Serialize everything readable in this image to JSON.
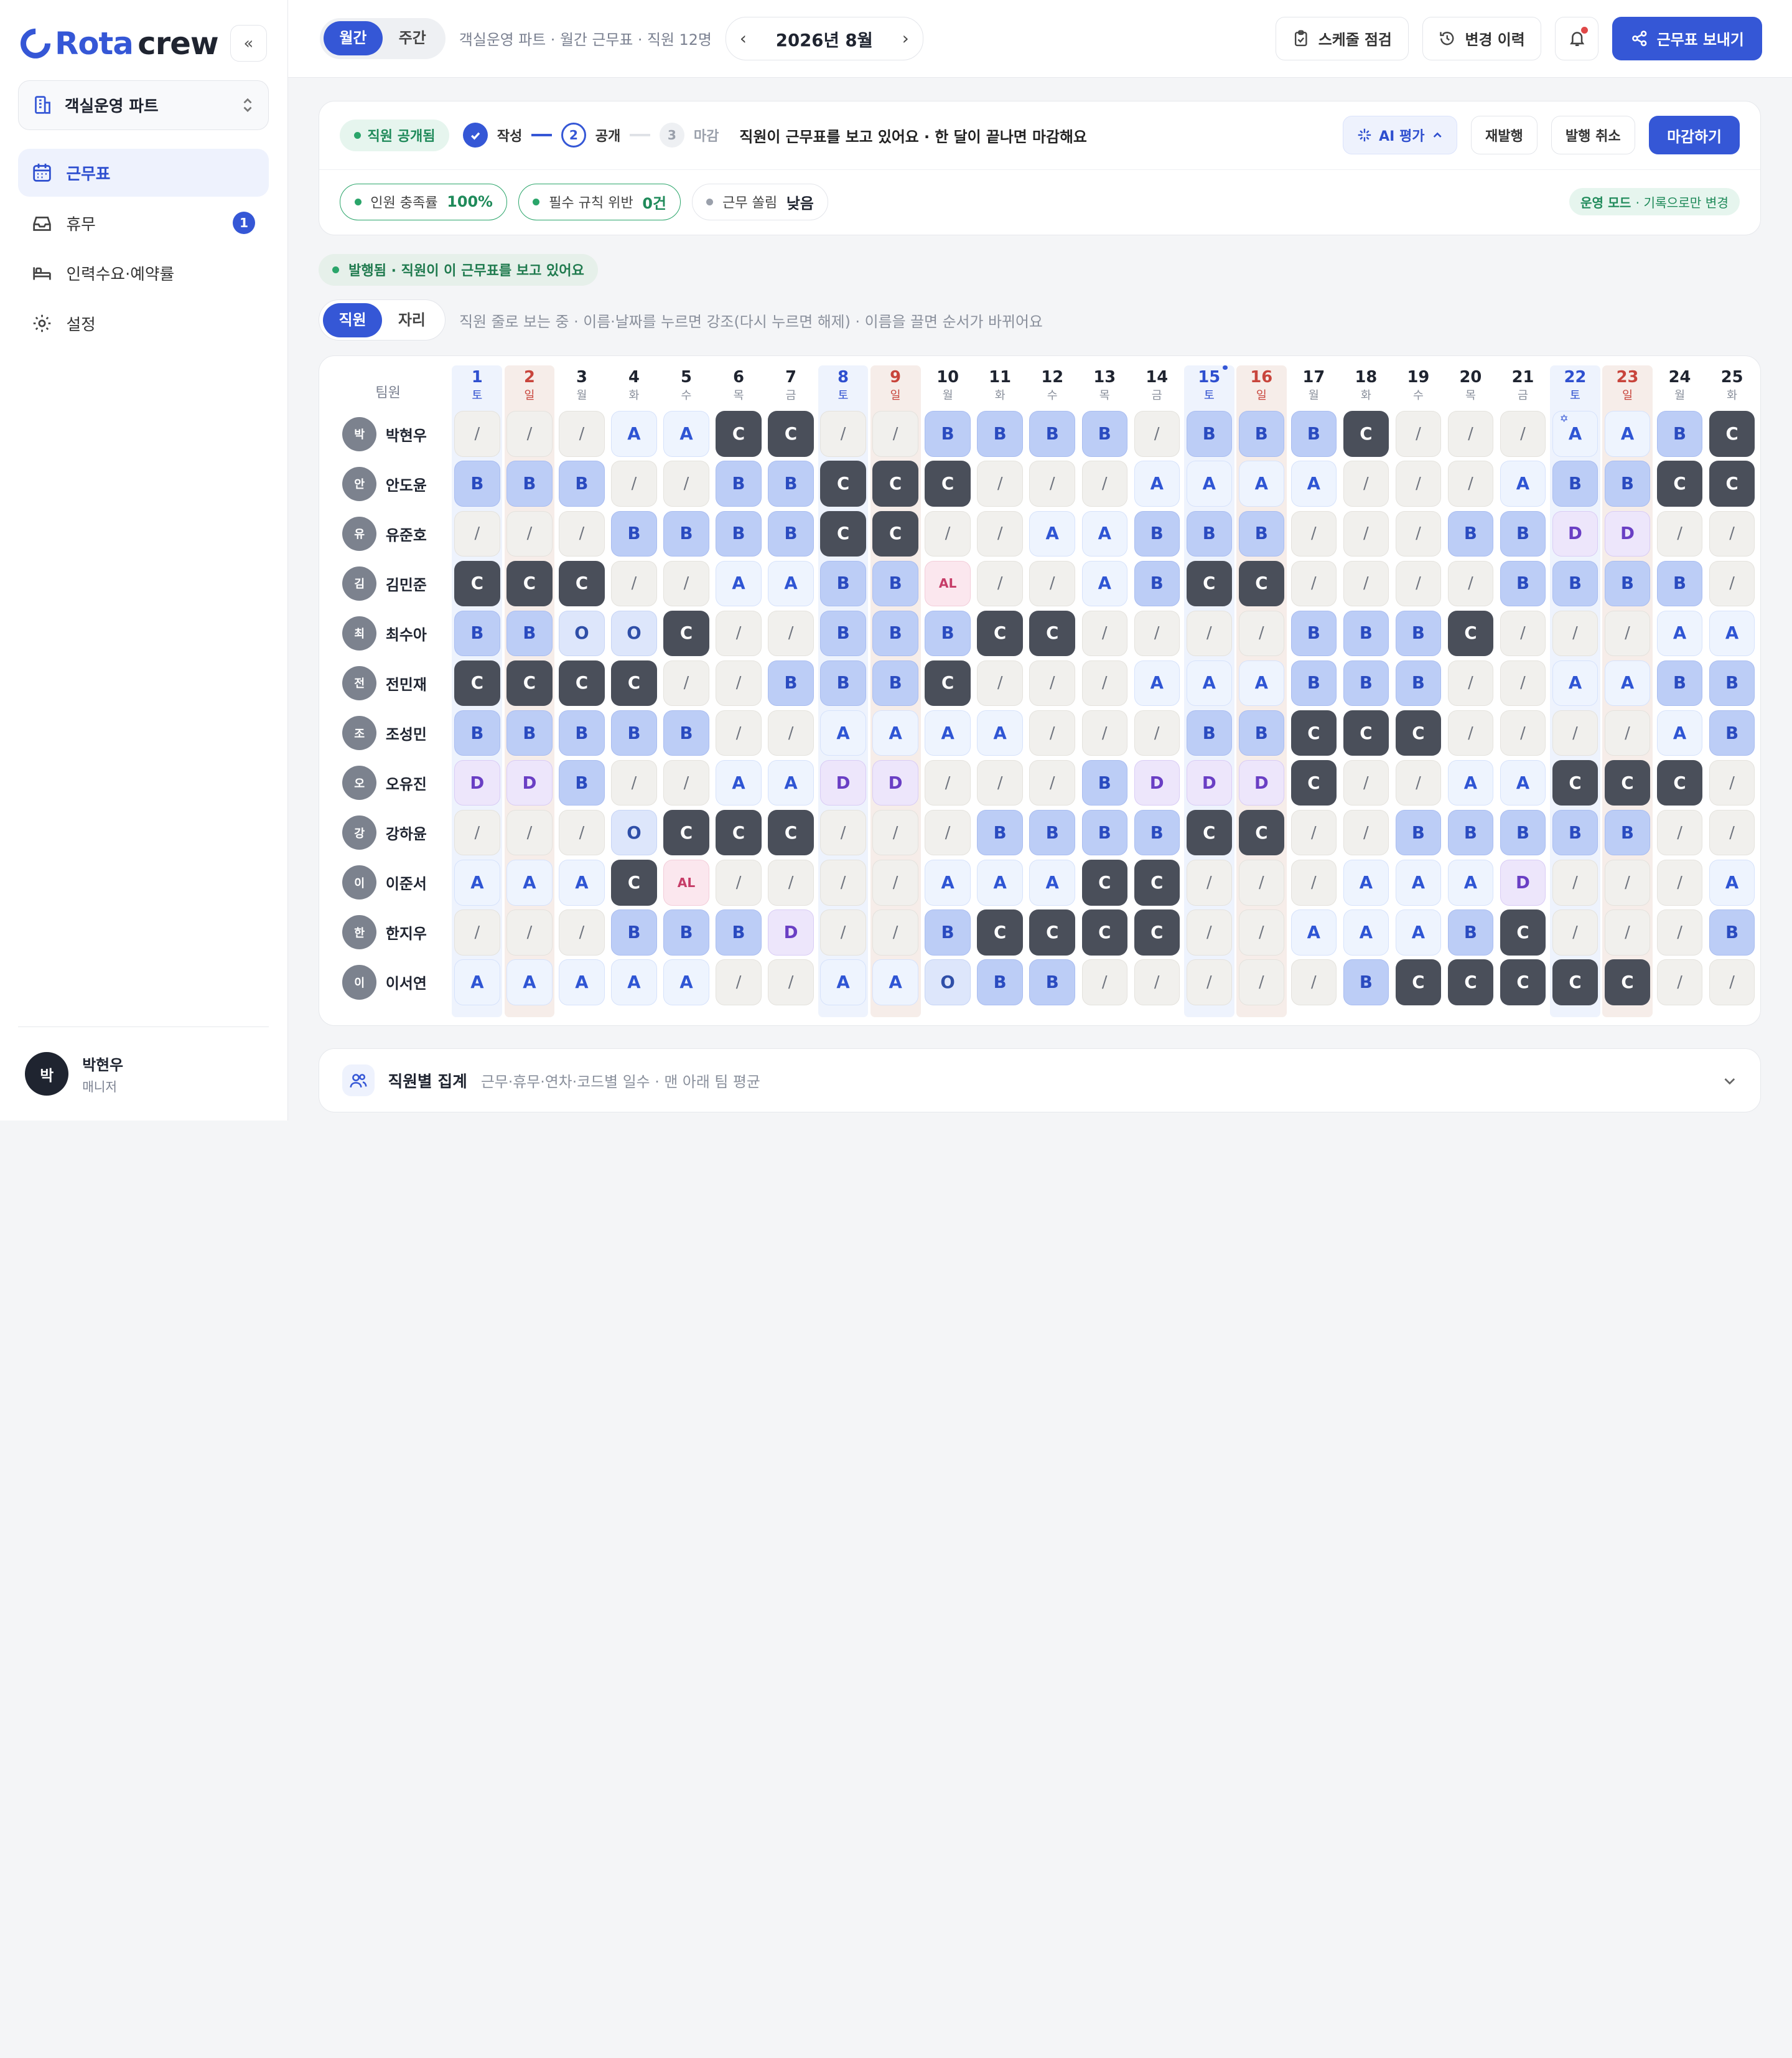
{
  "app": {
    "logo_rota": "Rota",
    "logo_crew": "crew",
    "collapse_glyph": "«"
  },
  "sidebar": {
    "team": "객실운영 파트",
    "items": [
      {
        "label": "근무표",
        "icon": "calendar-icon",
        "active": true
      },
      {
        "label": "휴무",
        "icon": "inbox-icon",
        "badge": "1"
      },
      {
        "label": "인력수요·예약률",
        "icon": "bed-icon"
      },
      {
        "label": "설정",
        "icon": "gear-icon"
      }
    ],
    "user": {
      "initial": "박",
      "name": "박현우",
      "role": "매니저"
    }
  },
  "topbar": {
    "view_monthly": "월간",
    "view_weekly": "주간",
    "crumb": "객실운영 파트 · 월간 근무표 · 직원 12명",
    "month": "2026년 8월",
    "prev": "‹",
    "next": "›",
    "check_btn": "스케줄 점검",
    "history_btn": "변경 이력",
    "send_btn": "근무표 보내기"
  },
  "status": {
    "state_pill": "직원 공개됨",
    "step1": "작성",
    "step2_num": "2",
    "step2": "공개",
    "step3_num": "3",
    "step3": "마감",
    "message": "직원이 근무표를 보고 있어요 · 한 달이 끝나면 마감해요",
    "ai_btn": "AI 평가",
    "reissue_btn": "재발행",
    "cancel_btn": "발행 취소",
    "close_btn": "마감하기",
    "metric1_label": "인원 충족률",
    "metric1_value": "100%",
    "metric2_label": "필수 규칙 위반",
    "metric2_value": "0건",
    "metric3_label": "근무 쏠림",
    "metric3_value": "낮음",
    "mode_bold": "운영 모드",
    "mode_rest": "· 기록으로만 변경"
  },
  "published_pill": "발행됨 · 직원이 이 근무표를 보고 있어요",
  "view": {
    "by_staff": "직원",
    "by_seat": "자리",
    "hint": "직원 줄로 보는 중 · 이름·날짜를 누르면 강조(다시 누르면 해제) · 이름을 끌면 순서가 바뀌어요"
  },
  "grid": {
    "team_header": "팀원",
    "days": [
      {
        "n": "1",
        "w": "토",
        "t": "sat"
      },
      {
        "n": "2",
        "w": "일",
        "t": "sun"
      },
      {
        "n": "3",
        "w": "월"
      },
      {
        "n": "4",
        "w": "화"
      },
      {
        "n": "5",
        "w": "수"
      },
      {
        "n": "6",
        "w": "목"
      },
      {
        "n": "7",
        "w": "금"
      },
      {
        "n": "8",
        "w": "토",
        "t": "sat"
      },
      {
        "n": "9",
        "w": "일",
        "t": "sun"
      },
      {
        "n": "10",
        "w": "월"
      },
      {
        "n": "11",
        "w": "화"
      },
      {
        "n": "12",
        "w": "수"
      },
      {
        "n": "13",
        "w": "목"
      },
      {
        "n": "14",
        "w": "금"
      },
      {
        "n": "15",
        "w": "토",
        "t": "sat",
        "dot": true
      },
      {
        "n": "16",
        "w": "일",
        "t": "sun"
      },
      {
        "n": "17",
        "w": "월"
      },
      {
        "n": "18",
        "w": "화"
      },
      {
        "n": "19",
        "w": "수"
      },
      {
        "n": "20",
        "w": "목"
      },
      {
        "n": "21",
        "w": "금"
      },
      {
        "n": "22",
        "w": "토",
        "t": "sat"
      },
      {
        "n": "23",
        "w": "일",
        "t": "sun"
      },
      {
        "n": "24",
        "w": "월"
      },
      {
        "n": "25",
        "w": "화"
      }
    ],
    "staff": [
      {
        "initial": "박",
        "name": "박현우",
        "shifts": [
          "/",
          "/",
          "/",
          "A",
          "A",
          "C",
          "C",
          "/",
          "/",
          "B",
          "B",
          "B",
          "B",
          "/",
          "B",
          "B",
          "B",
          "C",
          "/",
          "/",
          "/",
          "A*",
          "A",
          "B",
          "C"
        ]
      },
      {
        "initial": "안",
        "name": "안도윤",
        "shifts": [
          "B",
          "B",
          "B",
          "/",
          "/",
          "B",
          "B",
          "C",
          "C",
          "C",
          "/",
          "/",
          "/",
          "A",
          "A",
          "A",
          "A",
          "/",
          "/",
          "/",
          "A",
          "B",
          "B",
          "C",
          "C"
        ]
      },
      {
        "initial": "유",
        "name": "유준호",
        "shifts": [
          "/",
          "/",
          "/",
          "B",
          "B",
          "B",
          "B",
          "C",
          "C",
          "/",
          "/",
          "A",
          "A",
          "B",
          "B",
          "B",
          "/",
          "/",
          "/",
          "B",
          "B",
          "D",
          "D",
          "/",
          "/"
        ]
      },
      {
        "initial": "김",
        "name": "김민준",
        "shifts": [
          "C",
          "C",
          "C",
          "/",
          "/",
          "A",
          "A",
          "B",
          "B",
          "AL",
          "/",
          "/",
          "A",
          "B",
          "C",
          "C",
          "/",
          "/",
          "/",
          "/",
          "B",
          "B",
          "B",
          "B",
          "/"
        ]
      },
      {
        "initial": "최",
        "name": "최수아",
        "shifts": [
          "B",
          "B",
          "O",
          "O",
          "C",
          "/",
          "/",
          "B",
          "B",
          "B",
          "C",
          "C",
          "/",
          "/",
          "/",
          "/",
          "B",
          "B",
          "B",
          "C",
          "/",
          "/",
          "/",
          "A",
          "A"
        ]
      },
      {
        "initial": "전",
        "name": "전민재",
        "shifts": [
          "C",
          "C",
          "C",
          "C",
          "/",
          "/",
          "B",
          "B",
          "B",
          "C",
          "/",
          "/",
          "/",
          "A",
          "A",
          "A",
          "B",
          "B",
          "B",
          "/",
          "/",
          "A",
          "A",
          "B",
          "B"
        ]
      },
      {
        "initial": "조",
        "name": "조성민",
        "shifts": [
          "B",
          "B",
          "B",
          "B",
          "B",
          "/",
          "/",
          "A",
          "A",
          "A",
          "A",
          "/",
          "/",
          "/",
          "B",
          "B",
          "C",
          "C",
          "C",
          "/",
          "/",
          "/",
          "/",
          "A",
          "B"
        ]
      },
      {
        "initial": "오",
        "name": "오유진",
        "shifts": [
          "D",
          "D",
          "B",
          "/",
          "/",
          "A",
          "A",
          "D",
          "D",
          "/",
          "/",
          "/",
          "B",
          "D",
          "D",
          "D",
          "C",
          "/",
          "/",
          "A",
          "A",
          "C",
          "C",
          "C",
          "/"
        ]
      },
      {
        "initial": "강",
        "name": "강하윤",
        "shifts": [
          "/",
          "/",
          "/",
          "O",
          "C",
          "C",
          "C",
          "/",
          "/",
          "/",
          "B",
          "B",
          "B",
          "B",
          "C",
          "C",
          "/",
          "/",
          "B",
          "B",
          "B",
          "B",
          "B",
          "/",
          "/"
        ]
      },
      {
        "initial": "이",
        "name": "이준서",
        "shifts": [
          "A",
          "A",
          "A",
          "C",
          "AL",
          "/",
          "/",
          "/",
          "/",
          "A",
          "A",
          "A",
          "C",
          "C",
          "/",
          "/",
          "/",
          "A",
          "A",
          "A",
          "D",
          "/",
          "/",
          "/",
          "A"
        ]
      },
      {
        "initial": "한",
        "name": "한지우",
        "shifts": [
          "/",
          "/",
          "/",
          "B",
          "B",
          "B",
          "D",
          "/",
          "/",
          "B",
          "C",
          "C",
          "C",
          "C",
          "/",
          "/",
          "A",
          "A",
          "A",
          "B",
          "C",
          "/",
          "/",
          "/",
          "B"
        ]
      },
      {
        "initial": "이",
        "name": "이서연",
        "shifts": [
          "A",
          "A",
          "A",
          "A",
          "A",
          "/",
          "/",
          "A",
          "A",
          "O",
          "B",
          "B",
          "/",
          "/",
          "/",
          "/",
          "/",
          "B",
          "C",
          "C",
          "C",
          "C",
          "C",
          "/",
          "/"
        ]
      }
    ]
  },
  "summary": {
    "title": "직원별 집계",
    "desc": "근무·휴무·연차·코드별 일수 · 맨 아래 팀 평균"
  }
}
